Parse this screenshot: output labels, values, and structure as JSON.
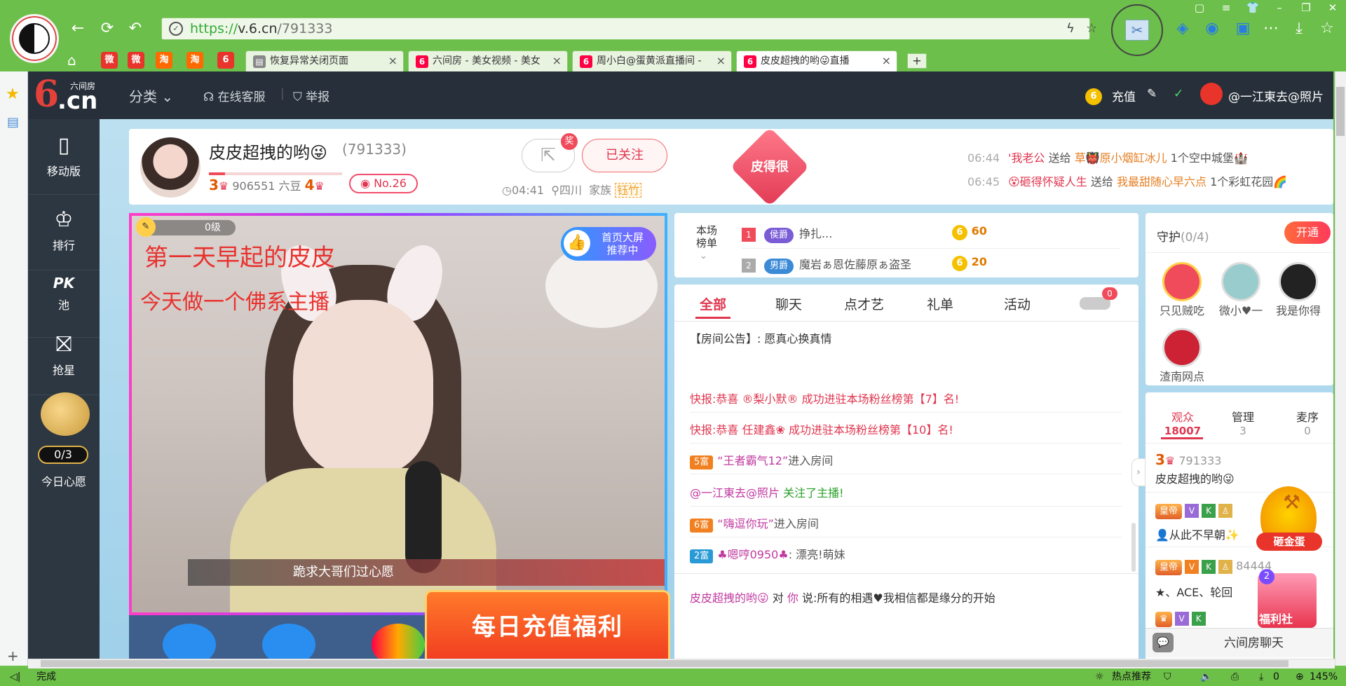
{
  "browser": {
    "url_scheme": "https://",
    "url_host": "v.6.cn",
    "url_path": "/791333",
    "tabs": [
      {
        "label": "恢复异常关闭页面"
      },
      {
        "label": "六间房 - 美女视频 - 美女"
      },
      {
        "label": "周小白@蛋黄派直播间 -"
      },
      {
        "label": "皮皮超拽的哟😜直播"
      }
    ],
    "new_tab": "+",
    "quick_icons": [
      "weibo-icon",
      "weibo-icon",
      "taobao-icon",
      "taobao-icon",
      "six-icon"
    ],
    "status_left": "完成",
    "status_right": {
      "hot": "热点推荐",
      "count": "0",
      "zoom": "145%"
    }
  },
  "site": {
    "logo_small": "六间房",
    "logo_num": "6",
    "logo_cn": ".cn",
    "nav": {
      "category": "分类",
      "service": "在线客服",
      "report": "举报"
    },
    "recharge": "充值",
    "username": "@一江東去@照片"
  },
  "left_nav": {
    "mobile": "移动版",
    "rank": "排行",
    "pk": "池",
    "pk_label": "PK",
    "grab": "抢星",
    "wish_count": "0/3",
    "wish": "今日心愿"
  },
  "anchor": {
    "name": "皮皮超拽的哟😜",
    "room_id": "(791333)",
    "level_a": "3",
    "beans": "906551 六豆",
    "level_b": "4",
    "rank_no": "No.26",
    "jiang": "奖",
    "follow": "已关注",
    "live_time": "04:41",
    "location": "四川",
    "family_label": "家族",
    "family": "钰竹",
    "badge": "皮得很"
  },
  "gifts": [
    {
      "time": "06:44",
      "from": "'我老公",
      "verb": "送给",
      "to": "草👹原小烟缸冰儿",
      "item": "1个空中城堡"
    },
    {
      "time": "06:45",
      "from": "😵砸得怀疑人生",
      "verb": "送给",
      "to": "我最甜随心早六点",
      "item": "1个彩虹花园"
    }
  ],
  "video": {
    "level": "0级",
    "text1": "第一天早起的皮皮",
    "text2": "今天做一个佛系主播",
    "screen_badge_line1": "首页大屏",
    "screen_badge_line2": "推荐中",
    "wish_bar": "跪求大哥们过心愿",
    "promo": "每日充值福利"
  },
  "ranking": {
    "title": "本场榜单",
    "rows": [
      {
        "no": "1",
        "badge": "侯爵",
        "name": "挣扎...",
        "value": "60"
      },
      {
        "no": "2",
        "badge": "男爵",
        "name": "魔岩ぁ恩佐藤原ぁ盗圣",
        "value": "20"
      }
    ]
  },
  "chat": {
    "tabs": [
      "全部",
      "聊天",
      "点才艺",
      "礼单",
      "活动"
    ],
    "car_count": "0",
    "notice_label": "【房间公告】:",
    "notice": "愿真心换真情",
    "msgs": [
      {
        "type": "flash",
        "text": "快报:恭喜 ®梨小默® 成功进驻本场粉丝榜第【7】名!"
      },
      {
        "type": "flash",
        "text": "快报:恭喜 任建鑫❀ 成功进驻本场粉丝榜第【10】名!"
      },
      {
        "type": "enter",
        "badge": "5富",
        "name": "“王者霸气12”",
        "tail": "进入房间"
      },
      {
        "type": "follow",
        "name": "@一江東去@照片",
        "tail": "关注了主播!"
      },
      {
        "type": "enter",
        "badge": "6富",
        "name": "“嗨逗你玩”",
        "tail": "进入房间"
      },
      {
        "type": "say",
        "badge": "2富",
        "name": "♣嗯哼0950♣",
        "tail": ": 漂亮!萌妹"
      }
    ],
    "footer": {
      "from": "皮皮超拽的哟😜",
      "to_label": "对",
      "to": "你",
      "say": "说:",
      "text": "所有的相遇♥我相信都是缘分的开始"
    }
  },
  "guard": {
    "title": "守护",
    "count": "(0/4)",
    "open": "开通",
    "members": [
      "只见贼吃",
      "微小♥一",
      "我是你得",
      "渣南网点"
    ]
  },
  "audience": {
    "tabs": [
      {
        "label": "观众",
        "count": "18007"
      },
      {
        "label": "管理",
        "count": "3"
      },
      {
        "label": "麦序",
        "count": "0"
      }
    ],
    "users": [
      {
        "level": "3",
        "id": "791333",
        "name": "皮皮超拽的哟😜"
      },
      {
        "badge": "皇帝",
        "name": "👤从此不早朝✨"
      },
      {
        "badge": "皇帝",
        "id": "84444",
        "name": "★、ACE、轮回"
      }
    ],
    "egg": "砸金蛋",
    "fuli": "福利社",
    "fuli_count": "2",
    "chatroom": "六间房聊天"
  },
  "colors": {
    "accent": "#e0364f",
    "chrome": "#6bbf4a",
    "nav": "#27303a"
  }
}
